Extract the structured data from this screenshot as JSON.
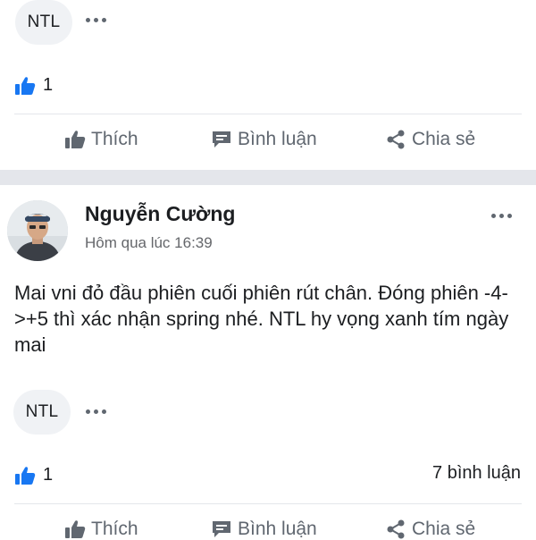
{
  "feed": {
    "post_prev": {
      "chip_label": "NTL",
      "likes": "1",
      "actions": {
        "like": "Thích",
        "comment": "Bình luận",
        "share": "Chia sẻ"
      }
    },
    "post": {
      "author": "Nguyễn Cường",
      "timestamp": "Hôm qua lúc 16:39",
      "body": "Mai vni đỏ đầu phiên cuối phiên rút chân. Đóng phiên -4->+5 thì xác nhận spring nhé. NTL hy vọng xanh tím ngày mai",
      "chip_label": "NTL",
      "likes": "1",
      "comments_count": "7 bình luận",
      "actions": {
        "like": "Thích",
        "comment": "Bình luận",
        "share": "Chia sẻ"
      }
    }
  },
  "icons": {
    "like_reaction": "thumbs-up-circle-icon",
    "like_action": "thumbs-up-icon",
    "comment_action": "chat-bubble-icon",
    "share_action": "share-icon",
    "more": "more-dots-icon"
  },
  "colors": {
    "like_blue": "#1877f2",
    "muted_text": "#606770",
    "separator": "#e4e6eb",
    "chip_bg": "#f0f2f5"
  }
}
